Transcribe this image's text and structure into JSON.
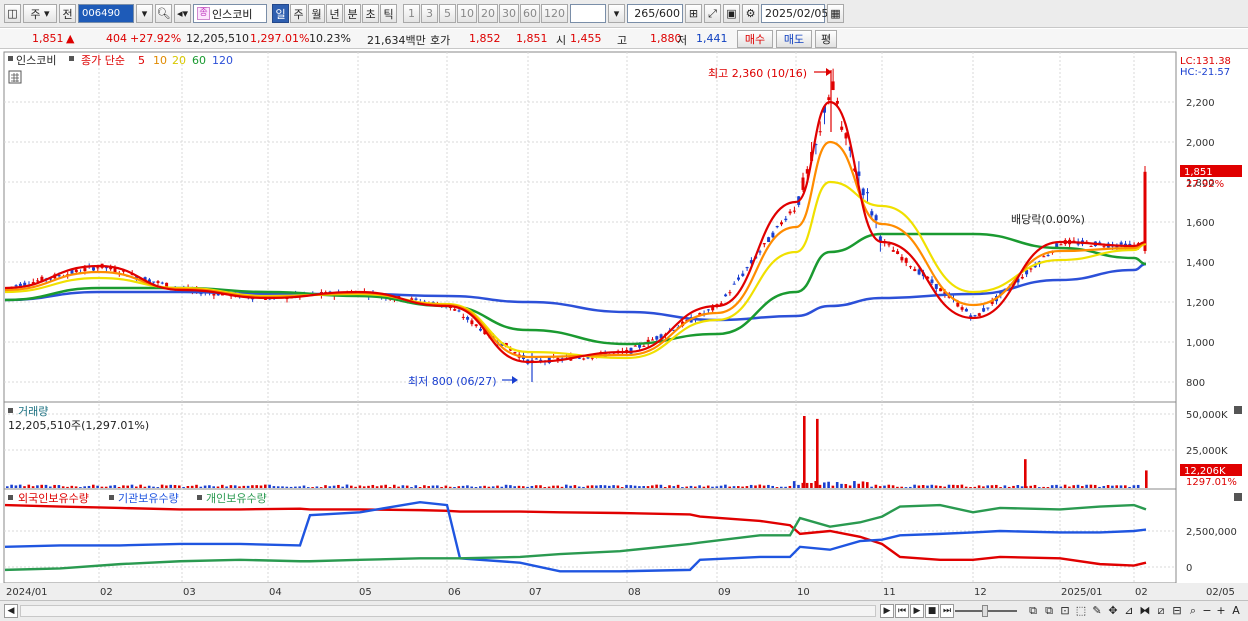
{
  "toolbar": {
    "period_type": "주",
    "prev": "전",
    "code": "006490",
    "stock_name": "인스코비",
    "stock_badge": "종",
    "tabs": [
      "일",
      "주",
      "월",
      "년",
      "분",
      "초",
      "틱"
    ],
    "active_tab": "일",
    "intervals": [
      "1",
      "3",
      "5",
      "10",
      "20",
      "30",
      "60",
      "120"
    ],
    "count": "265",
    "count_total": "/600",
    "date": "2025/02/05"
  },
  "quote": {
    "price": "1,851",
    "arrow": "▲",
    "change": "404",
    "change_pct": "+27.92%",
    "volume": "12,205,510",
    "volume_pct": "1,297.01%",
    "turnover": "10.23%",
    "amount": "21,634백만",
    "hoga_label": "호가",
    "ask": "1,852",
    "bid": "1,851",
    "open_label": "시",
    "open": "1,455",
    "high_label": "고",
    "high": "1,880",
    "low_label": "저",
    "low": "1,441",
    "buy_label": "매수",
    "sell_label": "매도",
    "eval_label": "평"
  },
  "legend": {
    "name": "인스코비",
    "ma_prefix": "종가 단순",
    "ma5": "5",
    "ma10": "10",
    "ma20": "20",
    "ma60": "60",
    "ma120": "120"
  },
  "price_panel": {
    "lc": "LC:131.38",
    "hc": "HC:-21.57",
    "high_note": "최고 2,360 (10/16)",
    "low_note": "최저 800 (06/27)",
    "dividend_note": "배당락(0.00%)",
    "last_price": "1,851",
    "last_pct": "27.92%"
  },
  "volume_panel": {
    "title": "거래량",
    "value": "12,205,510주(1,297.01%)",
    "ticks": [
      "50,000K",
      "25,000K"
    ],
    "last": "12,206K",
    "last_pct": "1297.01%"
  },
  "holders_panel": {
    "series": [
      "외국인보유수량",
      "기관보유수량",
      "개인보유수량"
    ],
    "ticks": [
      "2,500,000",
      "0"
    ]
  },
  "xaxis": [
    "2024/01",
    "02",
    "03",
    "04",
    "05",
    "06",
    "07",
    "08",
    "09",
    "10",
    "11",
    "12",
    "2025/01",
    "02",
    "02/05"
  ],
  "colors": {
    "up": "#e00000",
    "down": "#1a3fd0",
    "ma5": "#e00000",
    "ma10": "#ff8c00",
    "ma20": "#f0e000",
    "ma60": "#1a9a30",
    "ma120": "#2c50d8",
    "foreign": "#e00000",
    "inst": "#1f55e0",
    "indiv": "#2a9a50"
  },
  "chart_data": {
    "type": "candlestick",
    "x": [
      "2024/01",
      "02",
      "03",
      "04",
      "05",
      "06",
      "07",
      "08",
      "09",
      "10",
      "11",
      "12",
      "2025/01",
      "02",
      "02/05"
    ],
    "price_axis": [
      800,
      1000,
      1200,
      1400,
      1600,
      1800,
      2000,
      2200
    ],
    "ma_close": {
      "x": [
        "2024/01",
        "02",
        "03",
        "04",
        "05",
        "06",
        "07",
        "08",
        "09",
        "10",
        "10/16",
        "11",
        "12",
        "2025/01",
        "02",
        "02/05"
      ],
      "ma5": [
        1270,
        1380,
        1260,
        1220,
        1250,
        1180,
        900,
        950,
        1180,
        1700,
        2200,
        1500,
        1120,
        1500,
        1480,
        1500
      ],
      "ma20": [
        1250,
        1320,
        1270,
        1230,
        1240,
        1190,
        950,
        920,
        1110,
        1450,
        1800,
        1680,
        1250,
        1410,
        1460,
        1490
      ],
      "ma60": [
        1210,
        1270,
        1270,
        1250,
        1230,
        1180,
        1060,
        990,
        1040,
        1250,
        1450,
        1540,
        1540,
        1470,
        1420,
        1390
      ],
      "ma120": [
        1210,
        1250,
        1250,
        1240,
        1240,
        1230,
        1200,
        1150,
        1110,
        1130,
        1180,
        1220,
        1240,
        1310,
        1360,
        1390
      ]
    },
    "high": {
      "value": 2360,
      "date": "10/16"
    },
    "low": {
      "value": 800,
      "date": "06/27"
    },
    "last": {
      "close": 1851,
      "open": 1455,
      "high": 1880,
      "low": 1441
    },
    "volume_axis": [
      25000000,
      50000000
    ],
    "volume_spikes": [
      {
        "x": "10",
        "value": 50000000
      },
      {
        "x": "10",
        "value": 48000000
      },
      {
        "x": "12",
        "value": 20000000
      },
      {
        "x": "02/05",
        "value": 12206000
      }
    ],
    "holders_axis": [
      0,
      2500000
    ]
  }
}
